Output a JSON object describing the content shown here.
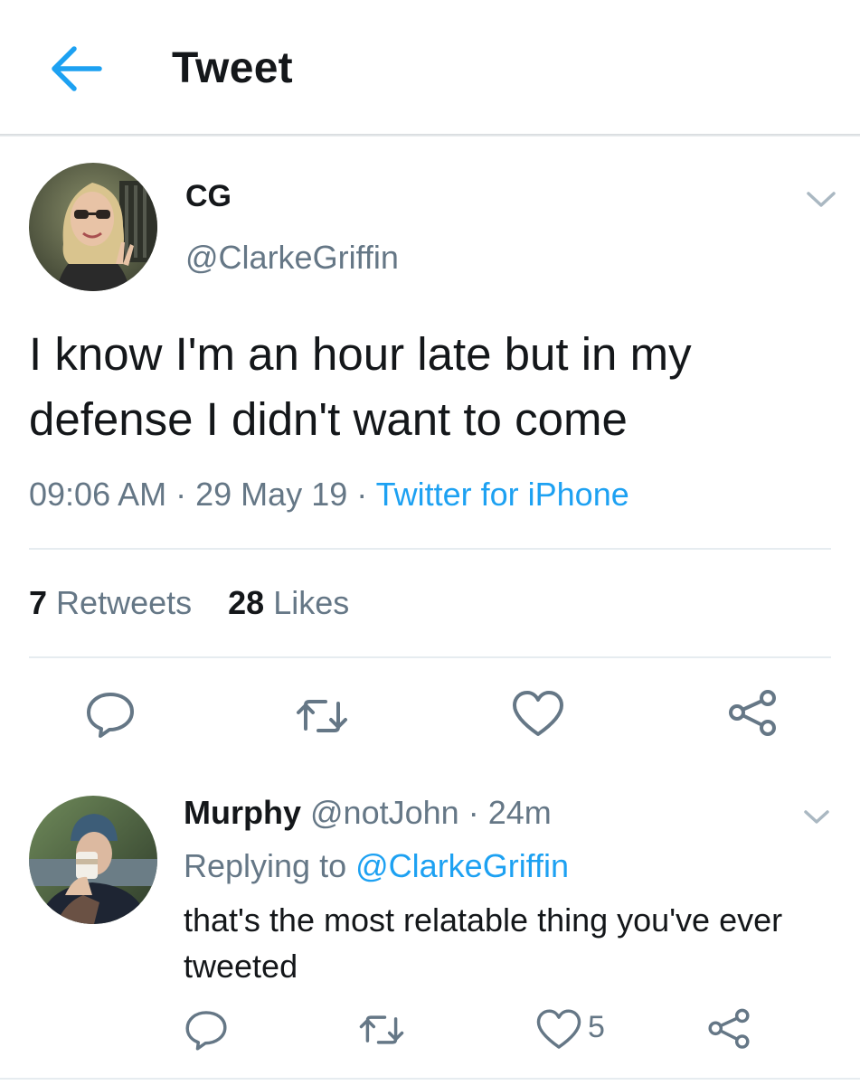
{
  "header": {
    "title": "Tweet",
    "back_icon": "arrow-left-icon",
    "accent": "#1da1f2"
  },
  "tweet": {
    "display_name": "CG",
    "handle": "@ClarkeGriffin",
    "text": "I know I'm an hour late but in my defense I didn't want to come",
    "time": "09:06 AM",
    "date": "29 May 19",
    "separator": "·",
    "source": "Twitter for iPhone",
    "retweets_count": "7",
    "retweets_label": "Retweets",
    "likes_count": "28",
    "likes_label": "Likes",
    "actions": [
      "reply-icon",
      "retweet-icon",
      "like-icon",
      "share-icon"
    ]
  },
  "reply": {
    "display_name": "Murphy",
    "handle": "@notJohn",
    "separator": "·",
    "age": "24m",
    "replying_to_label": "Replying to",
    "replying_to_handle": "@ClarkeGriffin",
    "text": "that's the most relatable thing you've ever tweeted",
    "like_count": "5",
    "actions": [
      "reply-icon",
      "retweet-icon",
      "like-icon",
      "share-icon"
    ]
  },
  "colors": {
    "text_primary": "#14171a",
    "text_secondary": "#657786",
    "link": "#1da1f2",
    "icon": "#657786",
    "divider": "#e6ecf0"
  }
}
